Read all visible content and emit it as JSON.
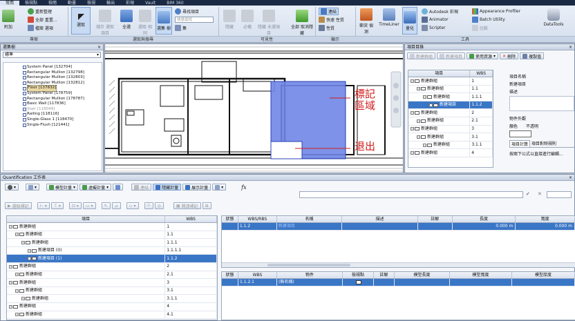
{
  "menu": {
    "tabs": [
      "常用",
      "檢視點",
      "檢閱",
      "動畫",
      "檢視",
      "輸出",
      "彩現",
      "Vault",
      "BIM 360"
    ],
    "active": 0
  },
  "ribbon": {
    "project_group": {
      "label": "專案",
      "append": "附加",
      "refresh": "重新整理",
      "reset_all": "全部 重置...",
      "file_options": "檔案 選項"
    },
    "select_group": {
      "label": "選取與搜尋",
      "select": "選取",
      "save_selection": "儲存 選取項目",
      "select_all": "全選",
      "select_same": "選取 相同",
      "selection_tree": "選集 樹",
      "find_items": "尋找項目",
      "quick_find_placeholder": "快速尋找",
      "set": "集"
    },
    "visibility_group": {
      "label": "可見性",
      "hide": "隱藏",
      "require": "必備",
      "hide_unselected": "隱藏 未選項目",
      "unhide_all": "全部 取消隱藏"
    },
    "display_group": {
      "label": "顯示",
      "links": "連結",
      "quick_props": "快速 性質",
      "properties": "性質"
    },
    "tools_group": {
      "label": "工具",
      "clash": "衝突 偵測",
      "timeliner": "TimeLiner",
      "quantification": "量化",
      "autodesk_rendering": "Autodesk 彩現",
      "animator": "Animator",
      "scripter": "Scripter",
      "appearance_profiler": "Appearance Profiler",
      "batch_utility": "Batch Utility",
      "compare": "比較",
      "datatools": "DataTools"
    }
  },
  "selection_tree": {
    "title": "選集樹",
    "mode": "標準",
    "items": [
      {
        "label": "System Panel [132704]",
        "state": "normal"
      },
      {
        "label": "Rectangular Mullion [132798]",
        "state": "normal"
      },
      {
        "label": "Rectangular Mullion [132803]",
        "state": "normal"
      },
      {
        "label": "Rectangular Mullion [132812]",
        "state": "normal"
      },
      {
        "label": "Floor [137832]",
        "state": "selected"
      },
      {
        "label": "System Panel [178759]",
        "state": "normal"
      },
      {
        "label": "Rectangular Mullion [178787]",
        "state": "normal"
      },
      {
        "label": "Basic Wall [117836]",
        "state": "normal"
      },
      {
        "label": "Stair [118049]",
        "state": "dim"
      },
      {
        "label": "Railing [118116]",
        "state": "normal"
      },
      {
        "label": "Single-Glass 1 [118470]",
        "state": "normal"
      },
      {
        "label": "Single-Flush [121441]",
        "state": "normal"
      }
    ]
  },
  "canvas": {
    "annotation_marked": "標記區域",
    "annotation_exit": "退出"
  },
  "item_catalog": {
    "title": "項目目錄",
    "toolbar": {
      "new_group": "新建群組",
      "new_item": "新建項目",
      "use_resource": "使用資源",
      "delete": "刪除",
      "copy_value": "複製值"
    },
    "columns": [
      "項目",
      "WBS"
    ],
    "rows": [
      {
        "indent": 0,
        "label": "新建群組",
        "wbs": "1"
      },
      {
        "indent": 1,
        "label": "新建群組",
        "wbs": "1.1"
      },
      {
        "indent": 2,
        "label": "新建群組",
        "wbs": "1.1.1"
      },
      {
        "indent": 3,
        "label": "新建項目",
        "wbs": "1.1.2",
        "selected": true
      },
      {
        "indent": 0,
        "label": "新建群組",
        "wbs": "2"
      },
      {
        "indent": 1,
        "label": "新建群組",
        "wbs": "2.1"
      },
      {
        "indent": 0,
        "label": "新建群組",
        "wbs": "3"
      },
      {
        "indent": 1,
        "label": "新建群組",
        "wbs": "3.1"
      },
      {
        "indent": 2,
        "label": "新建群組",
        "wbs": "3.1.1"
      },
      {
        "indent": 0,
        "label": "新建群組",
        "wbs": "4"
      }
    ],
    "props": {
      "item_name_label": "項目名稱",
      "item_name_value": "新建項目",
      "description_label": "描述",
      "object_appearance_label": "物件外觀",
      "color_label": "顏色",
      "opacity_value": "不透明",
      "tab_calc": "項目計算",
      "tab_rules": "項目對映規則",
      "formula_hint": "按兩下公式以直接進行編輯..."
    }
  },
  "quant_workbook": {
    "title": "Quantification 工作表",
    "toolbar": {
      "model_takeoff": "模型計量",
      "virtual_takeoff": "虛擬計量",
      "link": "連結",
      "hide_takeoff": "隱藏計量",
      "show_takeoff": "展示計量",
      "select_markup": "選取標記",
      "clear_markup": "開清標記",
      "fx": "fx"
    },
    "tree_columns": [
      "項目",
      "WBS"
    ],
    "tree_rows": [
      {
        "indent": 0,
        "label": "新建群組",
        "wbs": "1"
      },
      {
        "indent": 1,
        "label": "新建群組",
        "wbs": "1.1"
      },
      {
        "indent": 2,
        "label": "新建群組",
        "wbs": "1.1.1"
      },
      {
        "indent": 3,
        "label": "新建項目 (0)",
        "wbs": "1.1.1.1"
      },
      {
        "indent": 3,
        "label": "新建項目 (1)",
        "wbs": "1.1.2",
        "selected": true
      },
      {
        "indent": 0,
        "label": "新建群組",
        "wbs": "2"
      },
      {
        "indent": 1,
        "label": "新建群組",
        "wbs": "2.1"
      },
      {
        "indent": 0,
        "label": "新建群組",
        "wbs": "3"
      },
      {
        "indent": 1,
        "label": "新建群組",
        "wbs": "3.1"
      },
      {
        "indent": 2,
        "label": "新建群組",
        "wbs": "3.1.1"
      },
      {
        "indent": 0,
        "label": "新建群組",
        "wbs": "4"
      },
      {
        "indent": 1,
        "label": "新建群組",
        "wbs": "4.1"
      }
    ],
    "item_columns": [
      "狀態",
      "WBS/RBS",
      "名稱",
      "描述",
      "註解",
      "長度",
      "寬度"
    ],
    "item_row": {
      "wbs": "1.1.2",
      "name": "新建項目",
      "length": "0.000 m",
      "width": "0.000 m"
    },
    "object_columns": [
      "狀態",
      "WBS",
      "物件",
      "檢視點",
      "註解",
      "模型長度",
      "模型寬度",
      "模型厚度"
    ],
    "object_row": {
      "wbs": "1.1.2.1",
      "object": "(無名稱)"
    }
  },
  "colors": {
    "selection_blue": "#3a76c6",
    "highlight_volume": "#6f86e6",
    "annotation_red": "#d21a1a"
  }
}
